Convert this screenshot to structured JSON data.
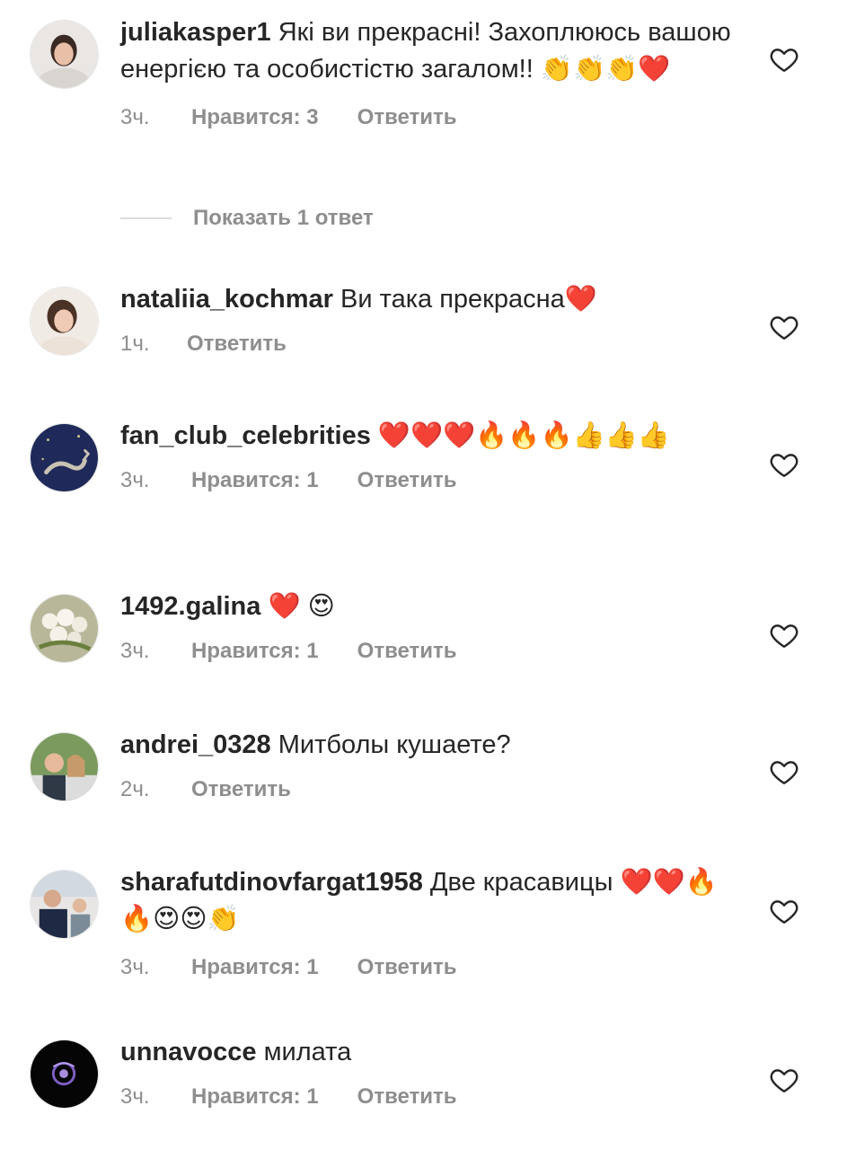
{
  "comments": [
    {
      "username": "juliakasper1",
      "text": "Які ви прекрасні! Захоплююсь вашою енергією та особистістю загалом!! 👏👏👏❤️",
      "time": "3ч.",
      "likes": "Нравится: 3",
      "reply": "Ответить",
      "avatar": "woman-portrait"
    },
    {
      "username": "nataliia_kochmar",
      "text": "Ви така прекрасна❤️",
      "time": "1ч.",
      "likes": "",
      "reply": "Ответить",
      "avatar": "woman-portrait"
    },
    {
      "username": "fan_club_celebrities",
      "text": "❤️❤️❤️🔥🔥🔥👍👍👍",
      "time": "3ч.",
      "likes": "Нравится: 1",
      "reply": "Ответить",
      "avatar": "scorpio-zodiac"
    },
    {
      "username": "1492.galina",
      "text": "❤️ 😍",
      "time": "3ч.",
      "likes": "Нравится: 1",
      "reply": "Ответить",
      "avatar": "flowers"
    },
    {
      "username": "andrei_0328",
      "text": "Митболы кушаете?",
      "time": "2ч.",
      "likes": "",
      "reply": "Ответить",
      "avatar": "couple-photo"
    },
    {
      "username": "sharafutdinovfargat1958",
      "text": "Две красавицы ❤️❤️🔥🔥😍😍👏",
      "time": "3ч.",
      "likes": "Нравится: 1",
      "reply": "Ответить",
      "avatar": "two-people"
    },
    {
      "username": "unnavocce",
      "text": "милата",
      "time": "3ч.",
      "likes": "Нравится: 1",
      "reply": "Ответить",
      "avatar": "dark-logo"
    }
  ],
  "view_replies": {
    "label": "Показать 1 ответ"
  },
  "colors": {
    "text": "#262626",
    "meta": "#8e8e8e",
    "divider": "#dbdbdb"
  }
}
